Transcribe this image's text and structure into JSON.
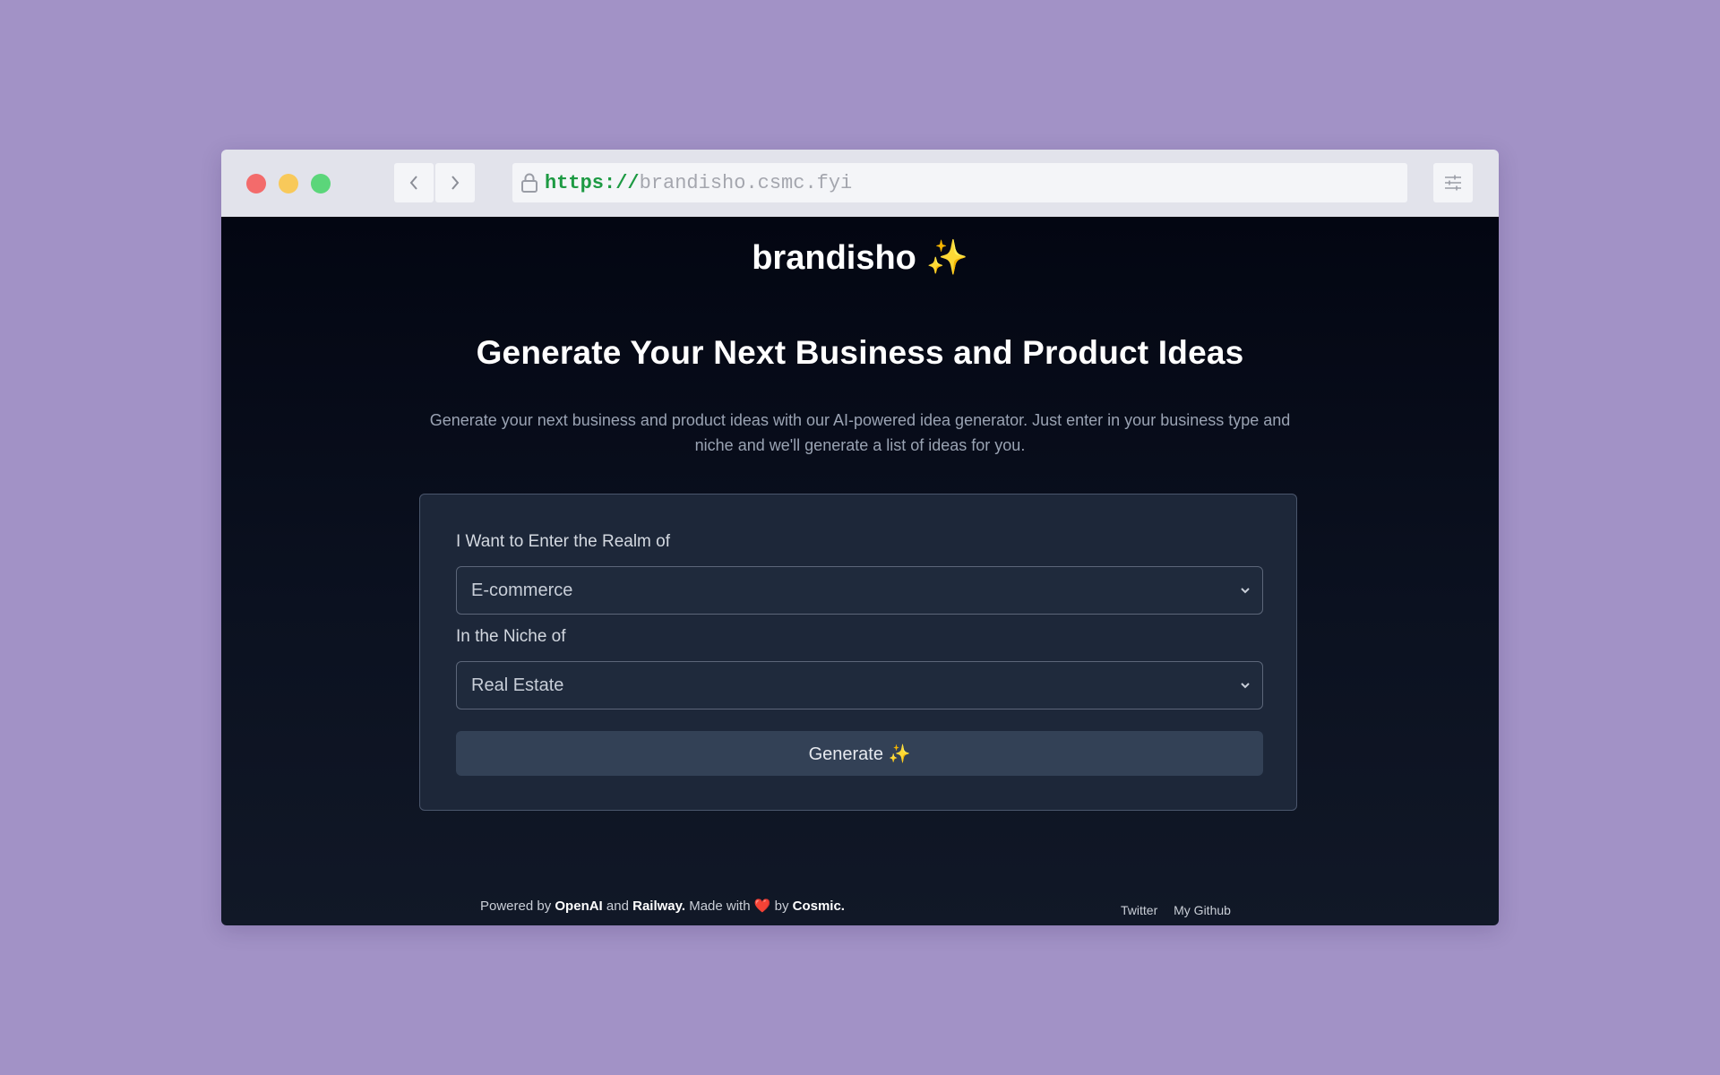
{
  "browser": {
    "url_scheme": "https://",
    "url_host": "brandisho.csmc.fyi"
  },
  "page": {
    "brand": "brandisho ✨",
    "headline": "Generate Your Next Business and Product Ideas",
    "description": "Generate your next business and product ideas with our AI-powered idea generator. Just enter in your business type and niche and we'll generate a list of ideas for you."
  },
  "form": {
    "realm_label": "I Want to Enter the Realm of",
    "realm_value": "E-commerce",
    "niche_label": "In the Niche of",
    "niche_value": "Real Estate",
    "generate_label": "Generate ✨"
  },
  "footer": {
    "powered_by": "Powered by",
    "openai": "OpenAI",
    "and": "and",
    "railway": "Railway.",
    "made_with": "Made with",
    "heart": "❤️",
    "by": "by",
    "cosmic": "Cosmic.",
    "links": [
      "Twitter",
      "My Github"
    ]
  },
  "colors": {
    "background": "#a292c6",
    "url_scheme": "#1d9a43",
    "card": "#1d2739",
    "button": "#334156"
  }
}
